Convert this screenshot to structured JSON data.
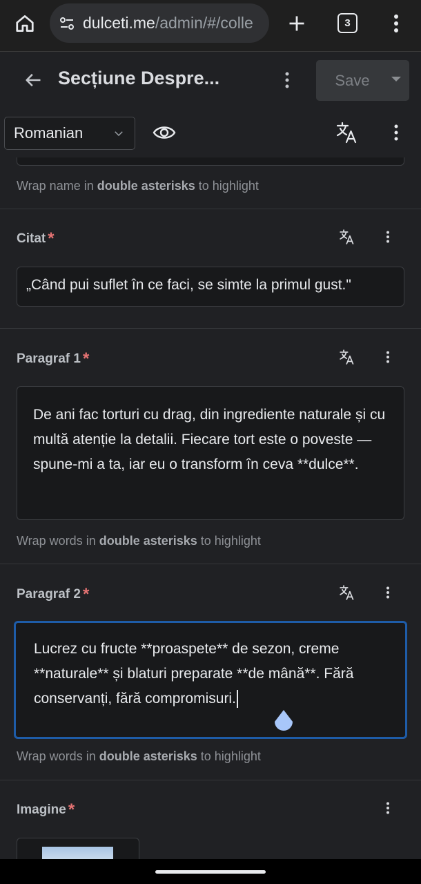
{
  "browser": {
    "url_host": "dulceti.me",
    "url_path": "/admin/#/colle",
    "tab_count": "3",
    "icons": [
      "home-icon",
      "tune-icon",
      "plus-icon",
      "more-vert-icon"
    ]
  },
  "header": {
    "title": "Secțiune Despre...",
    "save_label": "Save"
  },
  "toolbar": {
    "language": "Romanian"
  },
  "hint_top": {
    "prefix": "Wrap name in ",
    "bold": "double asterisks",
    "suffix": " to highlight"
  },
  "fields": {
    "citat": {
      "label": "Citat",
      "required": "*",
      "value": "„Când pui suflet în ce faci, se simte la primul gust.\""
    },
    "paragraf1": {
      "label": "Paragraf 1",
      "required": "*",
      "value": "De ani fac torturi cu drag, din ingrediente naturale și cu multă atenție la detalii. Fiecare tort este o poveste — spune-mi a ta, iar eu o transform în ceva **dulce**.",
      "hint_prefix": "Wrap words in ",
      "hint_bold": "double asterisks",
      "hint_suffix": " to highlight"
    },
    "paragraf2": {
      "label": "Paragraf 2",
      "required": "*",
      "value": "Lucrez cu fructe **proaspete** de sezon, creme **naturale** și blaturi preparate **de mână**. Fără conservanți, fără compromisuri.",
      "hint_prefix": "Wrap words in ",
      "hint_bold": "double asterisks",
      "hint_suffix": " to highlight"
    },
    "imagine": {
      "label": "Imagine",
      "required": "*"
    }
  },
  "colors": {
    "background": "#202124",
    "input_bg": "#18191b",
    "focus_border": "#1e5ca8",
    "required": "#e57373",
    "cursor_handle": "#a8c7fa"
  }
}
